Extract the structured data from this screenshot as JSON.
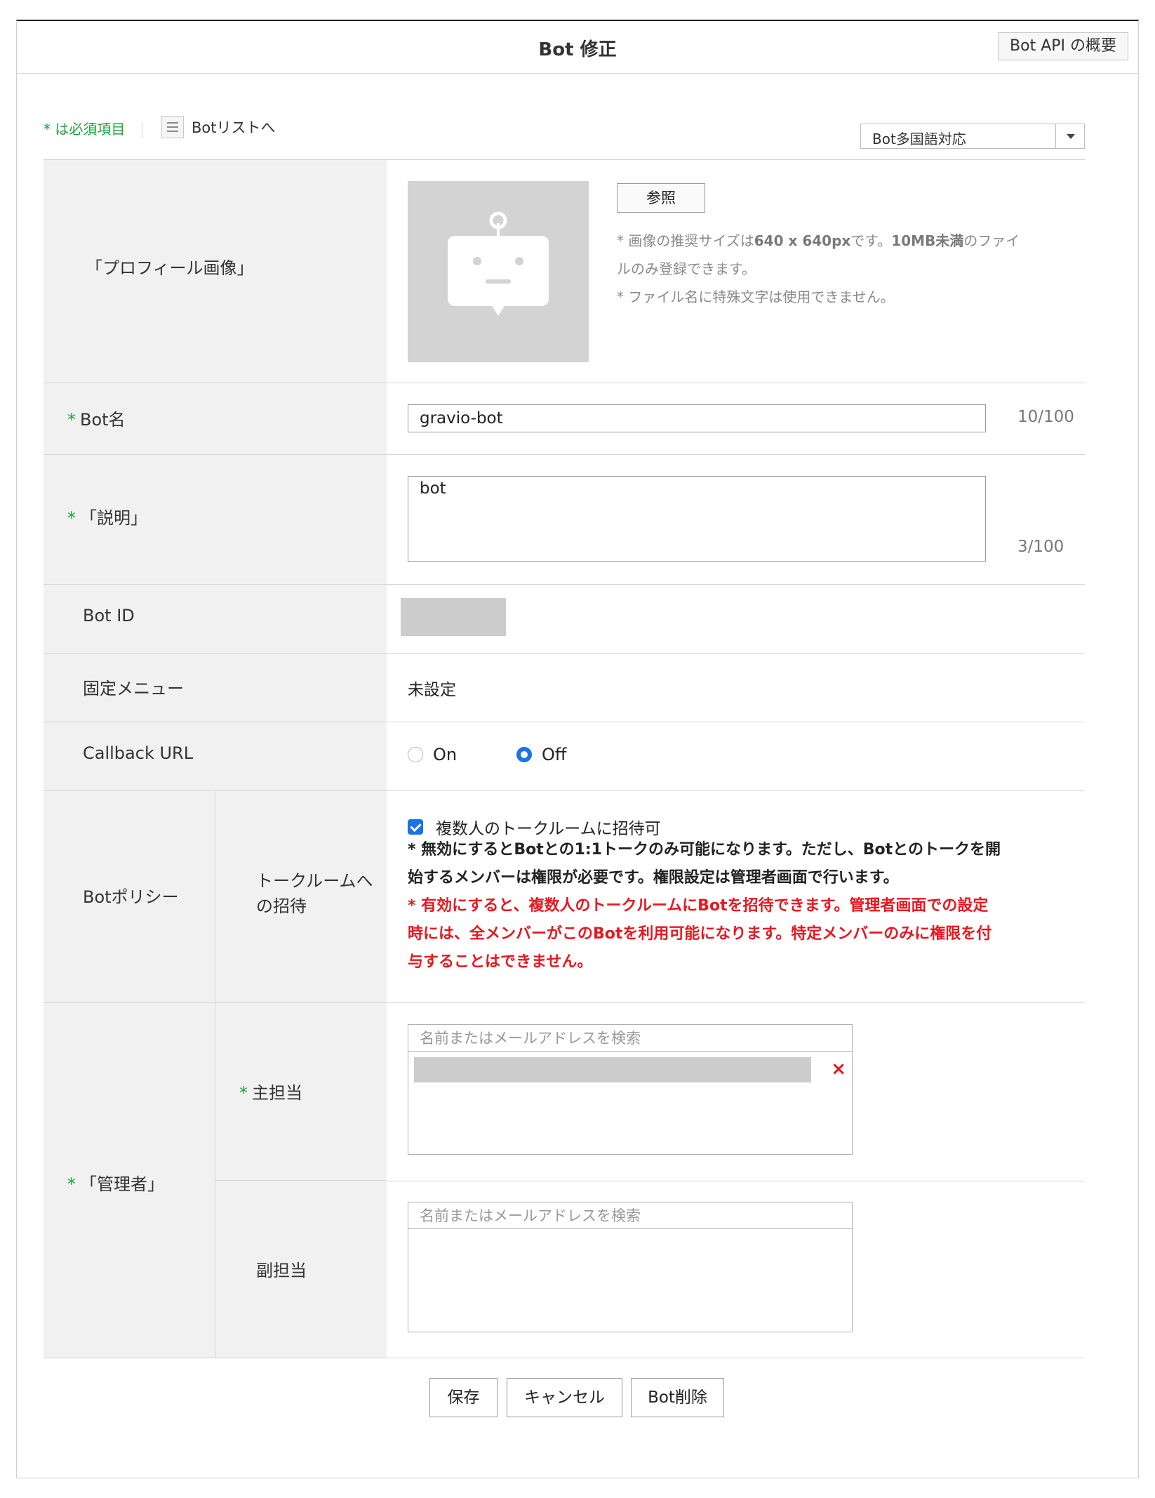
{
  "header": {
    "title": "Bot 修正",
    "api_button": "Bot API の概要"
  },
  "toolbar": {
    "required_note": "* は必須項目",
    "list_link": "Botリストへ",
    "language_select": "Bot多国語対応"
  },
  "profile": {
    "label": "「プロフィール画像」",
    "browse": "参照",
    "note_line1_a": "* 画像の推奨サイズは",
    "note_line1_b": "640 x 640px",
    "note_line1_c": "です。",
    "note_line1_d": "10MB未満",
    "note_line1_e": "のファイ",
    "note_line2": "ルのみ登録できます。",
    "note_line3": "* ファイル名に特殊文字は使用できません。"
  },
  "bot_name": {
    "required_mark": "*",
    "label": "Bot名",
    "value": "gravio-bot",
    "counter": "10/100"
  },
  "description": {
    "required_mark": "*",
    "label": "「説明」",
    "value": "bot",
    "counter": "3/100"
  },
  "bot_id": {
    "label": "Bot ID"
  },
  "fixed_menu": {
    "label": "固定メニュー",
    "value": "未設定"
  },
  "callback": {
    "label": "Callback URL",
    "on": "On",
    "off": "Off",
    "selected": "Off"
  },
  "policy": {
    "label": "Botポリシー",
    "sublabel_line1": "トークルームへ",
    "sublabel_line2": "の招待",
    "checkbox": "複数人のトークルームに招待可",
    "checked": true,
    "note_black_1": "* 無効にするとBotとの1:1トークのみ可能になります。ただし、Botとのトークを開",
    "note_black_2": "始するメンバーは権限が必要です。権限設定は管理者画面で行います。",
    "note_red_1": "* 有効にすると、複数人のトークルームにBotを招待できます。管理者画面での設定",
    "note_red_2": "時には、全メンバーがこのBotを利用可能になります。特定メンバーのみに権限を付",
    "note_red_3": "与することはできません。"
  },
  "admin": {
    "required_mark": "*",
    "label": "「管理者」",
    "primary_mark": "*",
    "primary_label": "主担当",
    "secondary_label": "副担当",
    "search_placeholder": "名前またはメールアドレスを検索",
    "remove_glyph": "×"
  },
  "actions": {
    "save": "保存",
    "cancel": "キャンセル",
    "delete": "Bot削除"
  },
  "colors": {
    "required_green": "#19a33b",
    "warning_red": "#e8171f",
    "accent_blue": "#1a73e8",
    "label_bg": "#f1f1f1"
  }
}
